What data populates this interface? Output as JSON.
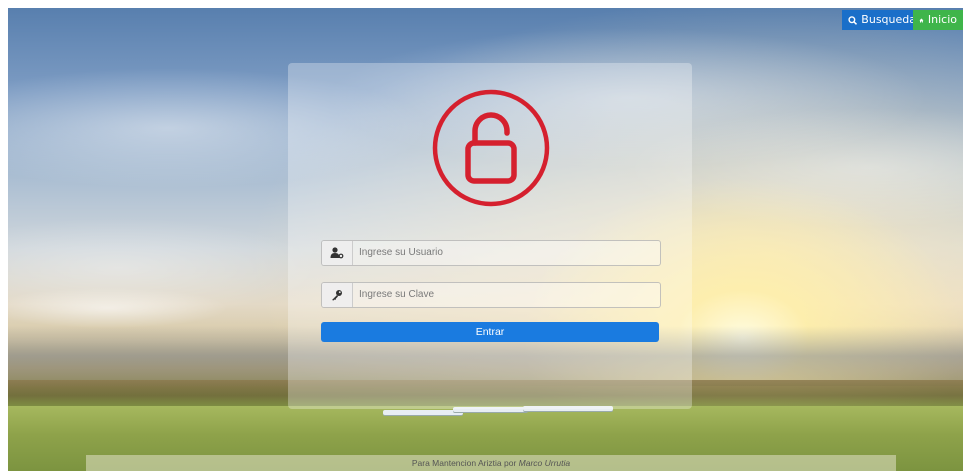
{
  "topbar": {
    "search_label": "Busqueda",
    "home_label": "Inicio"
  },
  "login": {
    "user_placeholder": "Ingrese su Usuario",
    "password_placeholder": "Ingrese su Clave",
    "submit_label": "Entrar"
  },
  "footer": {
    "prefix": "Para Mantencion Ariztia por",
    "author": "Marco Urrutia"
  },
  "icons": {
    "logo": "unlock-circle-icon",
    "search": "search-icon",
    "home": "home-icon",
    "user": "user-key-icon",
    "password": "key-icon"
  },
  "colors": {
    "logo_red": "#d5202e",
    "search_blue": "#1a6fc9",
    "home_green": "#3fb54a",
    "submit_blue": "#1a7be0"
  }
}
